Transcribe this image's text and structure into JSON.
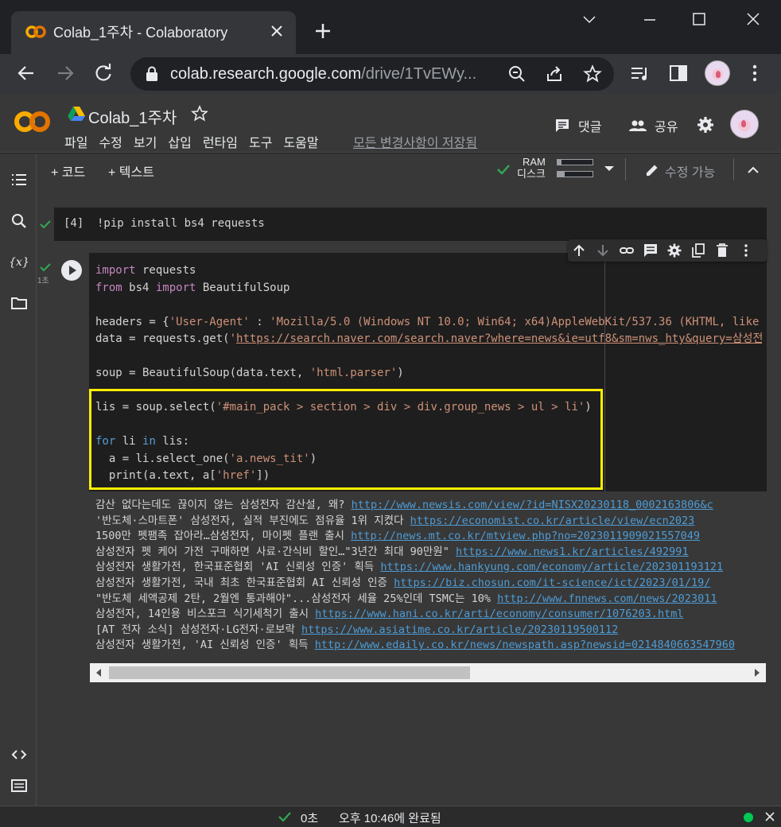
{
  "browser": {
    "tab_title": "Colab_1주차 - Colaboratory",
    "url_host": "colab.research.google.com",
    "url_path": "/drive/1TvEWy..."
  },
  "colab": {
    "notebook_title": "Colab_1주차",
    "menu": [
      "파일",
      "수정",
      "보기",
      "삽입",
      "런타임",
      "도구",
      "도움말"
    ],
    "save_status": "모든 변경사항이 저장됨",
    "comment_label": "댓글",
    "share_label": "공유",
    "add_code_label": "+ 코드",
    "add_text_label": "+ 텍스트",
    "ram_label": "RAM",
    "disk_label": "디스크",
    "ram_usage": 0.12,
    "disk_usage": 0.2,
    "edit_mode_label": "수정 가능"
  },
  "cells": {
    "cell1": {
      "exec_count": "[4]",
      "code": "!pip install bs4 requests"
    },
    "cell2": {
      "elapsed": "1초"
    }
  },
  "output_lines": [
    {
      "text": "감산 없다는데도 끊이지 않는 삼성전자 감산설, 왜? ",
      "url": "http://www.newsis.com/view/?id=NISX20230118_0002163806&c"
    },
    {
      "text": "'반도체·스마트폰' 삼성전자, 실적 부진에도 점유율 1위 지켰다 ",
      "url": "https://economist.co.kr/article/view/ecn2023"
    },
    {
      "text": "1500만 펫팸족 잡아라…삼성전자, 마이펫 플랜 출시 ",
      "url": "http://news.mt.co.kr/mtview.php?no=2023011909021557049"
    },
    {
      "text": "삼성전자 펫 케어 가전 구매하면 사료·간식비 할인…\"3년간 최대 90만원\" ",
      "url": "https://www.news1.kr/articles/492991"
    },
    {
      "text": "삼성전자 생활가전, 한국표준협회 'AI 신뢰성 인증' 획득 ",
      "url": "https://www.hankyung.com/economy/article/202301193121"
    },
    {
      "text": "삼성전자 생활가전, 국내 최초 한국표준협회 AI 신뢰성 인증 ",
      "url": "https://biz.chosun.com/it-science/ict/2023/01/19/"
    },
    {
      "text": "\"반도체 세액공제 2탄, 2월엔 통과해야\"...삼성전자 세율 25%인데 TSMC는 10% ",
      "url": "http://www.fnnews.com/news/2023011"
    },
    {
      "text": "삼성전자, 14인용 비스포크 식기세척기 출시 ",
      "url": "https://www.hani.co.kr/arti/economy/consumer/1076203.html"
    },
    {
      "text": "[AT 전자 소식] 삼성전자·LG전자·로보락 ",
      "url": "https://www.asiatime.co.kr/article/20230119500112"
    },
    {
      "text": "삼성전자 생활가전, 'AI 신뢰성 인증' 획득 ",
      "url": "http://www.edaily.co.kr/news/newspath.asp?newsid=0214840663547960"
    }
  ],
  "status": {
    "elapsed": "0초",
    "message": "오후 10:46에 완료됨"
  },
  "colors": {
    "accent_orange": "#f9ab00",
    "highlight_yellow": "#ffee00",
    "link_blue": "#4e9cd6",
    "success_green": "#00c853"
  },
  "icons": [
    "colab-logo-icon",
    "close-icon",
    "plus-icon",
    "minimize-icon",
    "maximize-icon",
    "back-icon",
    "forward-icon",
    "reload-icon",
    "lock-icon",
    "zoom-icon",
    "share-icon",
    "bookmark-star-icon",
    "media-icon",
    "side-panel-icon",
    "menu-dots-icon",
    "drive-icon",
    "star-icon",
    "comment-icon",
    "people-icon",
    "gear-icon",
    "toc-icon",
    "search-icon",
    "variables-icon",
    "folder-icon",
    "code-snippets-icon",
    "terminal-icon",
    "check-icon",
    "run-icon",
    "arrow-up-icon",
    "arrow-down-icon",
    "link-icon",
    "comment-icon",
    "mirror-icon",
    "delete-icon"
  ]
}
